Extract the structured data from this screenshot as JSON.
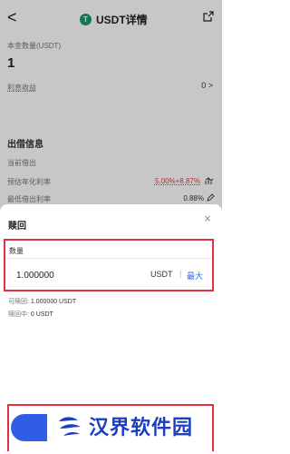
{
  "nav": {
    "back_glyph": "<",
    "coin_symbol": "T",
    "title": "USDT详情",
    "share_icon": "share-icon"
  },
  "summary": {
    "principal_label": "本金数量(USDT)",
    "principal_value": "1",
    "interest_label": "利息收益",
    "interest_value": "0 >"
  },
  "lending": {
    "section_title": "出借信息",
    "rows": [
      {
        "label": "当前借出",
        "value": ""
      },
      {
        "label": "预估年化利率",
        "value": "5.00%+8.87%"
      },
      {
        "label": "最低借出利率",
        "value": "0.88%"
      }
    ]
  },
  "redeem_sheet": {
    "title": "赎回",
    "close_glyph": "×",
    "quantity_label": "数量",
    "input_value": "1.000000",
    "unit": "USDT",
    "divider": "|",
    "max_label": "最大",
    "redeemable_label": "可赎回:",
    "redeemable_value": "1.000000 USDT",
    "redeeming_label": "赎回中:",
    "redeeming_value": "0 USDT"
  },
  "watermark": {
    "text": "汉界软件园"
  },
  "colors": {
    "accent_red": "#e2313c",
    "primary_blue": "#2f5de6",
    "link_blue": "#2f6fe4",
    "coin_green": "#139b77"
  }
}
